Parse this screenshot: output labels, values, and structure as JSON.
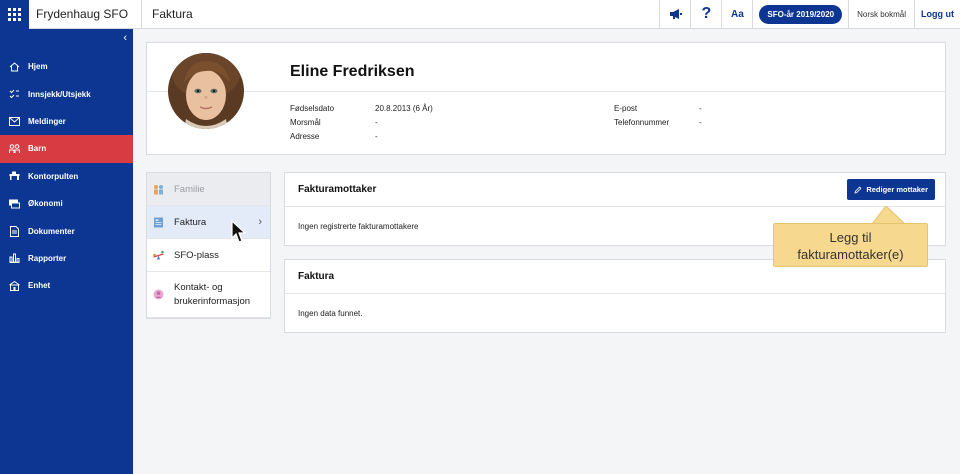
{
  "topbar": {
    "org_name": "Frydenhaug SFO",
    "breadcrumb": "Faktura",
    "help_label": "?",
    "font_label": "Aa",
    "year_label": "SFO-år 2019/2020",
    "language_label": "Norsk bokmål",
    "logout_label": "Logg ut"
  },
  "sidebar": {
    "items": [
      {
        "label": "Hjem",
        "icon": "home-icon"
      },
      {
        "label": "Innsjekk/Utsjekk",
        "icon": "checkin-icon"
      },
      {
        "label": "Meldinger",
        "icon": "mail-icon"
      },
      {
        "label": "Barn",
        "icon": "children-icon",
        "active": true
      },
      {
        "label": "Kontorpulten",
        "icon": "desk-icon"
      },
      {
        "label": "Økonomi",
        "icon": "money-icon"
      },
      {
        "label": "Dokumenter",
        "icon": "document-icon"
      },
      {
        "label": "Rapporter",
        "icon": "chart-icon"
      },
      {
        "label": "Enhet",
        "icon": "building-icon"
      }
    ],
    "active_color": "#d83b41",
    "bg_color": "#0d3692"
  },
  "profile": {
    "name": "Eline Fredriksen",
    "fields_left": [
      {
        "label": "Fødselsdato",
        "value": "20.8.2013 (6 År)"
      },
      {
        "label": "Morsmål",
        "value": "-"
      },
      {
        "label": "Adresse",
        "value": "-"
      }
    ],
    "fields_right": [
      {
        "label": "E-post",
        "value": "-"
      },
      {
        "label": "Telefonnummer",
        "value": "-"
      }
    ]
  },
  "tabs": [
    {
      "label": "Familie",
      "state": "disabled"
    },
    {
      "label": "Faktura",
      "state": "selected"
    },
    {
      "label": "SFO-plass",
      "state": "normal"
    },
    {
      "label": "Kontakt- og brukerinformasjon",
      "state": "normal"
    }
  ],
  "panels": {
    "recipients": {
      "title": "Fakturamottaker",
      "button_label": "Rediger mottaker",
      "empty_text": "Ingen registrerte fakturamottakere"
    },
    "invoices": {
      "title": "Faktura",
      "empty_text": "Ingen data funnet."
    }
  },
  "tooltip": {
    "line1": "Legg til",
    "line2": "fakturamottaker(e)"
  }
}
